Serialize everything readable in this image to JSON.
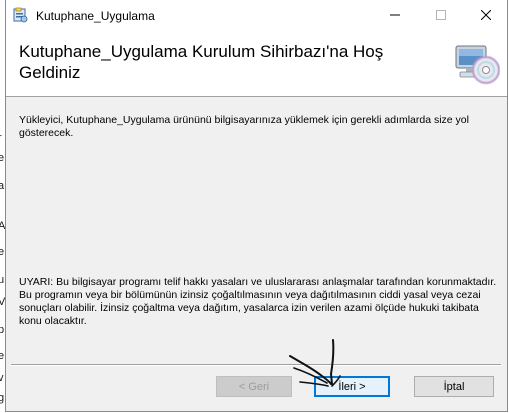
{
  "window": {
    "title": "Kutuphane_Uygulama"
  },
  "header": {
    "title": "Kutuphane_Uygulama Kurulum Sihirbazı'na Hoş Geldiniz"
  },
  "content": {
    "intro": "Yükleyici, Kutuphane_Uygulama ürününü bilgisayarınıza yüklemek için gerekli adımlarda size yol gösterecek.",
    "warning": "UYARI: Bu bilgisayar programı telif hakkı yasaları ve uluslararası anlaşmalar tarafından korunmaktadır. Bu programın veya bir bölümünün izinsiz çoğaltılmasının veya dağıtılmasının ciddi yasal veya cezai sonuçları olabilir. İzinsiz çoğaltma veya dağıtım, yasalarca izin verilen azami ölçüde hukuki takibata konu olacaktır."
  },
  "buttons": {
    "back_label": "< Geri",
    "next_label": "İleri >",
    "cancel_label": "İptal"
  },
  "background_window": {
    "fragments": [
      "r",
      "e",
      "a",
      "A",
      "e",
      "u",
      "V",
      "p",
      "e",
      "v",
      "g"
    ]
  },
  "icons": {
    "app": "installer-package-icon",
    "header": "computer-cd-icon",
    "minimize": "minimize-icon",
    "maximize": "maximize-icon",
    "close": "close-icon"
  },
  "colors": {
    "focus_border": "#0078d7",
    "dialog_background": "#f0f0f0"
  }
}
